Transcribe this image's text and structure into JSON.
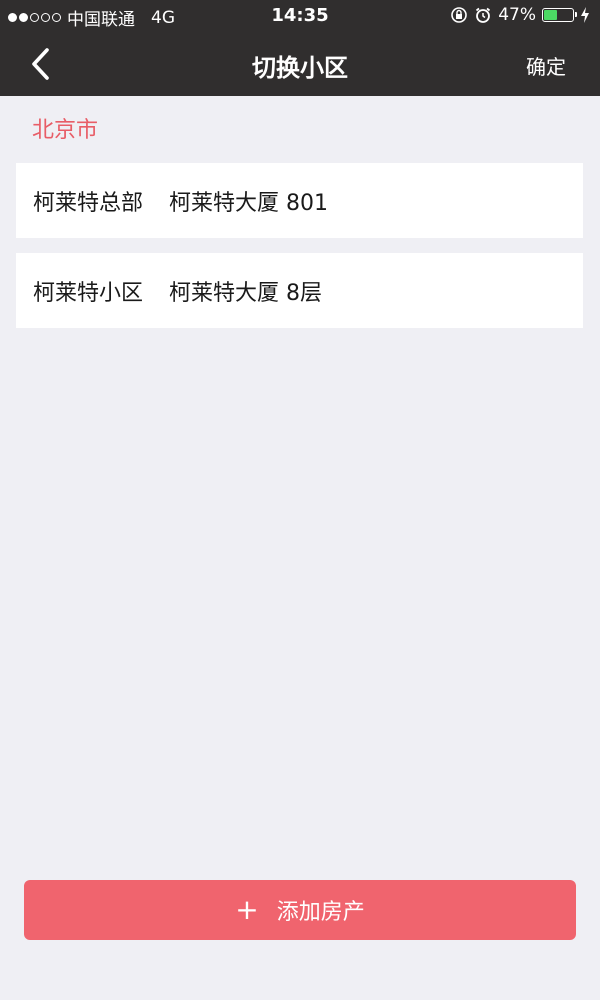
{
  "status_bar": {
    "carrier": "中国联通",
    "network": "4G",
    "time": "14:35",
    "battery_percent": "47%",
    "battery_level": 0.47,
    "battery_color": "#4cd964",
    "signal_bars_filled": 2,
    "signal_bars_total": 5
  },
  "nav": {
    "title": "切换小区",
    "confirm_label": "确定",
    "back_icon": "chevron-left-icon"
  },
  "city": "北京市",
  "communities": [
    {
      "name": "柯莱特总部",
      "address": "柯莱特大厦 801"
    },
    {
      "name": "柯莱特小区",
      "address": "柯莱特大厦 8层"
    }
  ],
  "add_button": {
    "label": "添加房产",
    "icon": "plus-icon"
  },
  "colors": {
    "accent": "#f0646e",
    "city_label": "#e85d67",
    "header_bg": "#302e2e",
    "page_bg": "#efeff4"
  }
}
